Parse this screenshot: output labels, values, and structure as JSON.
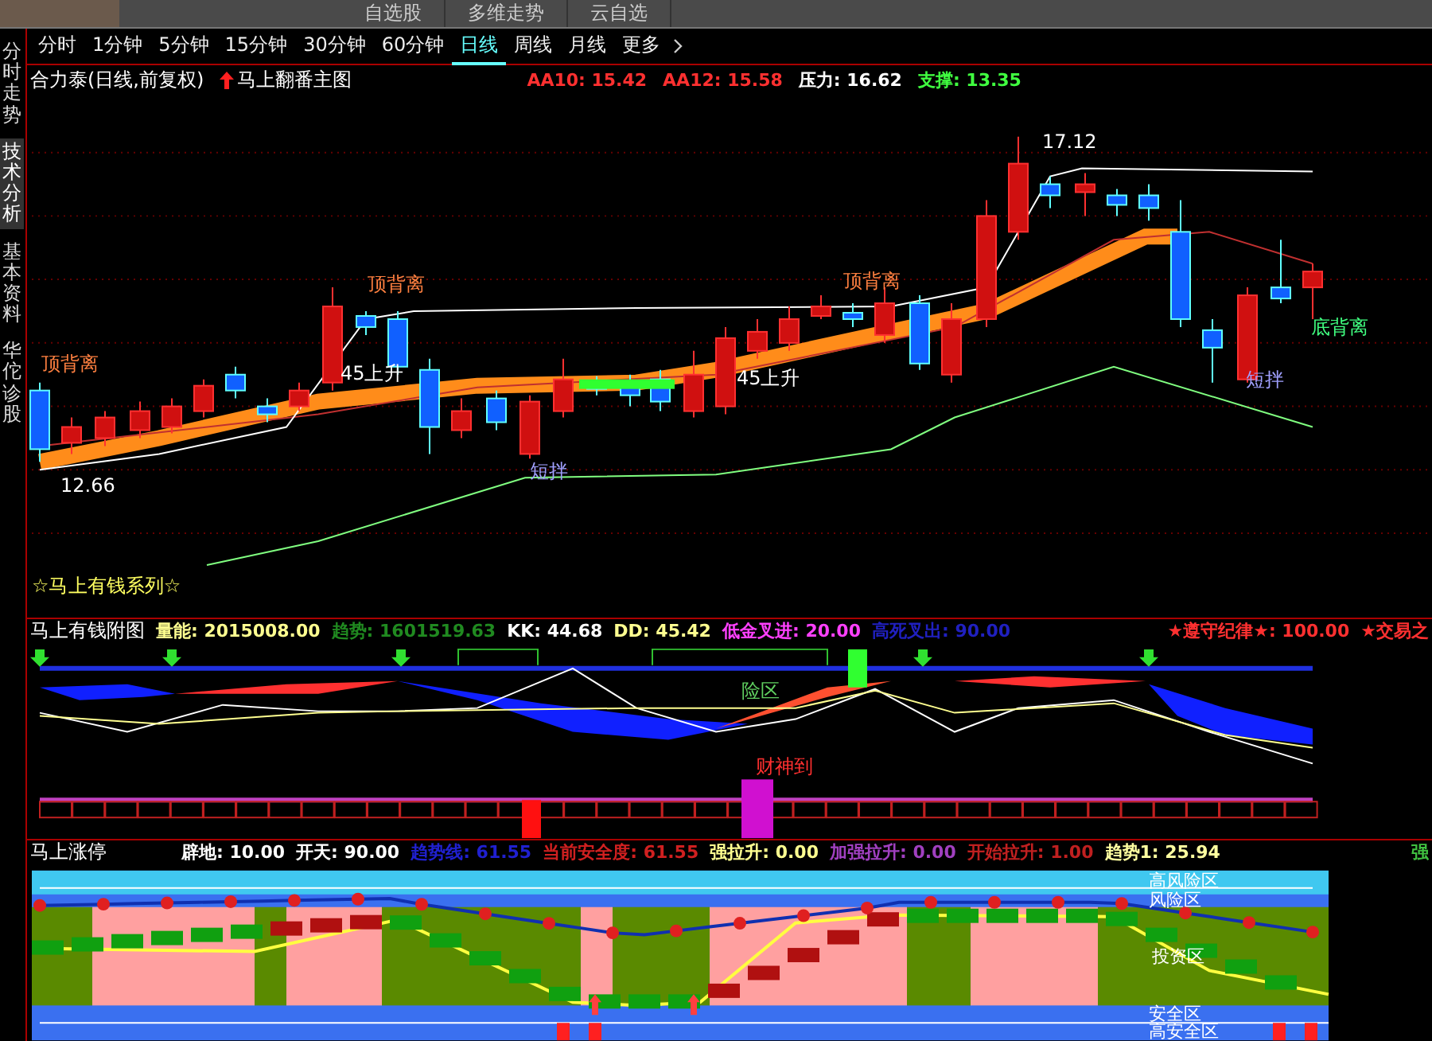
{
  "top_bar": {
    "buttons": [
      "自选股",
      "多维走势",
      "云自选"
    ]
  },
  "period_tabs": [
    {
      "label": "分时",
      "selected": false
    },
    {
      "label": "1分钟",
      "selected": false
    },
    {
      "label": "5分钟",
      "selected": false
    },
    {
      "label": "15分钟",
      "selected": false
    },
    {
      "label": "30分钟",
      "selected": false
    },
    {
      "label": "60分钟",
      "selected": false
    },
    {
      "label": "日线",
      "selected": true
    },
    {
      "label": "周线",
      "selected": false
    },
    {
      "label": "月线",
      "selected": false
    },
    {
      "label": "更多",
      "selected": false
    }
  ],
  "side_tabs": [
    {
      "label": "分时走势",
      "selected": false
    },
    {
      "label": "技术分析",
      "selected": true
    },
    {
      "label": "基本资料",
      "selected": false
    },
    {
      "label": "华佗诊股",
      "selected": false
    }
  ],
  "main_chart": {
    "title": "合力泰(日线,前复权)",
    "indicator": "马上翻番主图",
    "legend": [
      {
        "label": "AA10: 15.42",
        "color": "#ff3030"
      },
      {
        "label": "AA12: 15.58",
        "color": "#ff3030"
      },
      {
        "label": "压力: 16.62",
        "color": "#ffffff"
      },
      {
        "label": "支撑: 13.35",
        "color": "#40ff40"
      }
    ],
    "labels": [
      {
        "text": "17.12",
        "kind": "price"
      },
      {
        "text": "12.66",
        "kind": "price"
      },
      {
        "text": "顶背离",
        "kind": "top"
      },
      {
        "text": "顶背离",
        "kind": "top"
      },
      {
        "text": "顶背离",
        "kind": "top"
      },
      {
        "text": "底背离",
        "kind": "bottom"
      },
      {
        "text": "45上升",
        "kind": "trend"
      },
      {
        "text": "45上升",
        "kind": "trend"
      },
      {
        "text": "短拌",
        "kind": "short"
      },
      {
        "text": "短拌",
        "kind": "short"
      }
    ],
    "series_name": "☆马上有钱系列☆"
  },
  "sub_chart_1": {
    "title": "马上有钱附图",
    "legend": [
      {
        "label": "量能: 2015008.00",
        "color": "#ffff90"
      },
      {
        "label": "趋势: 1601519.63",
        "color": "#208a20"
      },
      {
        "label": "KK: 44.68",
        "color": "#ffffff"
      },
      {
        "label": "DD: 45.42",
        "color": "#ffff90"
      },
      {
        "label": "低金叉进: 20.00",
        "color": "#ff40ff"
      },
      {
        "label": "高死叉出: 90.00",
        "color": "#2020c0"
      }
    ],
    "legend_right": [
      {
        "label": "★遵守纪律★: 100.00",
        "color": "#ff3030"
      },
      {
        "label": "★交易之",
        "color": "#ff3030"
      }
    ],
    "labels": [
      {
        "text": "险区",
        "kind": "zone"
      },
      {
        "text": "财神到",
        "kind": "signal"
      }
    ]
  },
  "sub_chart_2": {
    "title": "马上涨停",
    "legend": [
      {
        "label": "辟地: 10.00",
        "color": "#ffffff"
      },
      {
        "label": "开天: 90.00",
        "color": "#ffffff"
      },
      {
        "label": "趋势线: 61.55",
        "color": "#2020d0"
      },
      {
        "label": "当前安全度: 61.55",
        "color": "#d02020"
      },
      {
        "label": "强拉升: 0.00",
        "color": "#ffff90"
      },
      {
        "label": "加强拉升: 0.00",
        "color": "#a040c0"
      },
      {
        "label": "开始拉升: 1.00",
        "color": "#c02020"
      },
      {
        "label": "趋势1: 25.94",
        "color": "#ffffa0"
      }
    ],
    "legend_right": [
      {
        "label": "强",
        "color": "#40c040"
      }
    ],
    "zones": [
      "高风险区",
      "风险区",
      "投资区",
      "安全区",
      "高安全区"
    ]
  }
}
